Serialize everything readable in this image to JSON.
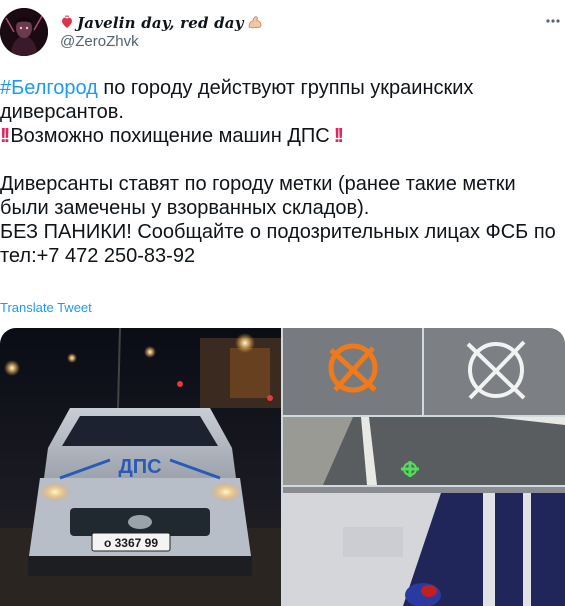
{
  "author": {
    "display_name": "Javelin day, red day",
    "handle": "@ZeroZhvk",
    "name_prefix_emoji": "anatomical-heart",
    "name_suffix_emoji": "flexed-biceps"
  },
  "tweet": {
    "hashtag": "#Белгород",
    "line1_rest": " по городу действуют группы украинских диверсантов.",
    "line2": "Возможно похищение машин ДПС",
    "line3": "Диверсанты ставят по городу метки (ранее такие метки были замечены у взорванных складов).",
    "line4": "БЕЗ ПАНИКИ! Сообщайте о подозрительных лицах ФСБ по тел:+7 472 250-83-92",
    "bang_emoji": "double-exclamation-mark"
  },
  "translate_label": "Translate Tweet",
  "media": {
    "photo1_text_dps": "ДПС",
    "photo1_plate": "о 3367 99"
  },
  "icons": {
    "more": "more-icon"
  },
  "colors": {
    "link": "#1d9bf0",
    "text": "#0f1419",
    "secondary": "#536471",
    "mark_orange": "#f07a1a",
    "mark_white": "#f2f2f2",
    "mark_green": "#4fe05a"
  }
}
